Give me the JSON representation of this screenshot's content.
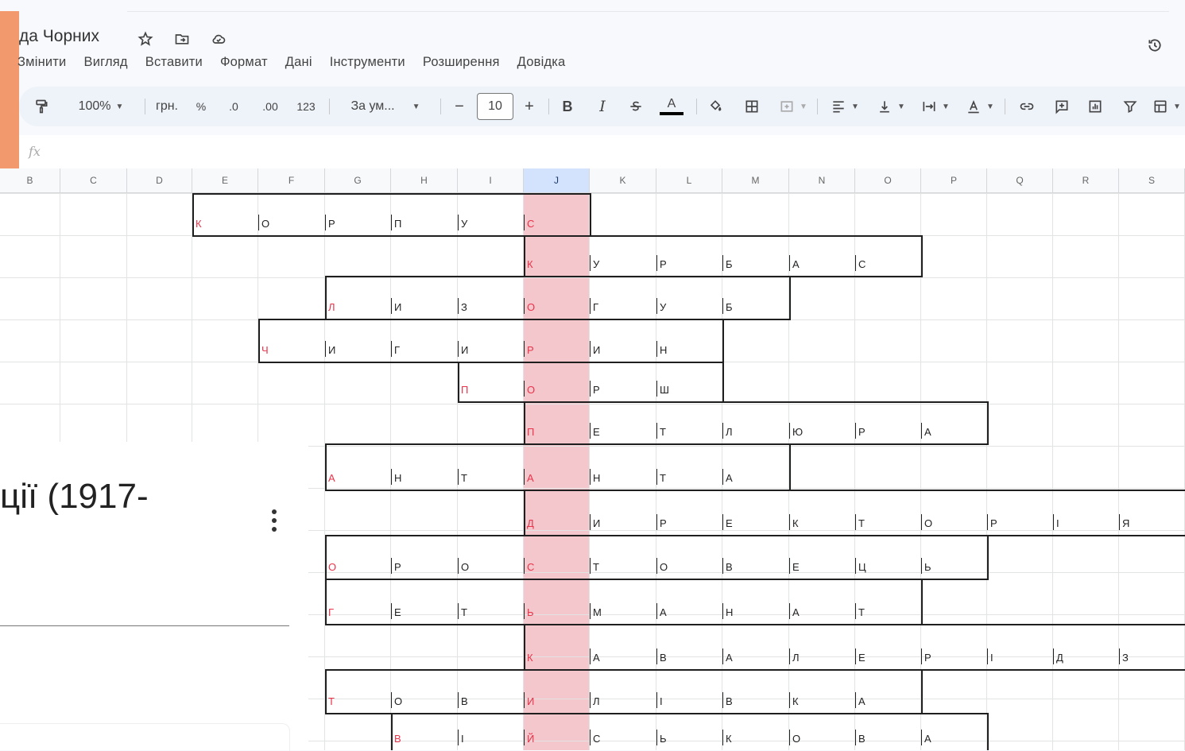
{
  "doc": {
    "title": "да Чорних"
  },
  "menu": [
    "Змінити",
    "Вигляд",
    "Вставити",
    "Формат",
    "Дані",
    "Інструменти",
    "Розширення",
    "Довідка"
  ],
  "toolbar": {
    "zoom": "100%",
    "currency": "грн.",
    "percent": "%",
    "dec_decrease": ".0",
    "dec_increase": ".00",
    "number_format": "123",
    "font": "За ум...",
    "minus": "−",
    "font_size": "10",
    "plus": "+",
    "bold": "B",
    "italic": "I",
    "text_color_glyph": "A"
  },
  "formula_bar": {
    "fx": "fx"
  },
  "columns": [
    "B",
    "C",
    "D",
    "E",
    "F",
    "G",
    "H",
    "I",
    "J",
    "K",
    "L",
    "M",
    "N",
    "O",
    "P",
    "Q",
    "R",
    "S"
  ],
  "selected_column": "J",
  "crossword": {
    "highlight_column": "J",
    "rows": [
      {
        "start": 3,
        "letters": [
          "К",
          "О",
          "Р",
          "П",
          "У",
          "С"
        ]
      },
      {
        "start": 8,
        "letters": [
          "К",
          "У",
          "Р",
          "Б",
          "А",
          "С"
        ]
      },
      {
        "start": 5,
        "letters": [
          "Л",
          "И",
          "З",
          "О",
          "Г",
          "У",
          "Б"
        ]
      },
      {
        "start": 4,
        "letters": [
          "Ч",
          "И",
          "Г",
          "И",
          "Р",
          "И",
          "Н"
        ]
      },
      {
        "start": 7,
        "letters": [
          "П",
          "О",
          "Р",
          "Ш"
        ]
      },
      {
        "start": 8,
        "letters": [
          "П",
          "Е",
          "Т",
          "Л",
          "Ю",
          "Р",
          "А"
        ]
      },
      {
        "start": 5,
        "letters": [
          "А",
          "Н",
          "Т",
          "А",
          "Н",
          "Т",
          "А"
        ]
      },
      {
        "start": 8,
        "letters": [
          "Д",
          "И",
          "Р",
          "Е",
          "К",
          "Т",
          "О",
          "Р",
          "І",
          "Я"
        ]
      },
      {
        "start": 5,
        "letters": [
          "О",
          "Р",
          "О",
          "С",
          "Т",
          "О",
          "В",
          "Е",
          "Ц",
          "Ь"
        ]
      },
      {
        "start": 5,
        "letters": [
          "Г",
          "Е",
          "Т",
          "Ь",
          "М",
          "А",
          "Н",
          "А",
          "Т"
        ]
      },
      {
        "start": 8,
        "letters": [
          "К",
          "А",
          "В",
          "А",
          "Л",
          "Е",
          "Р",
          "І",
          "Д",
          "З"
        ]
      },
      {
        "start": 5,
        "letters": [
          "Т",
          "О",
          "В",
          "И",
          "Л",
          "І",
          "В",
          "К",
          "А"
        ]
      },
      {
        "start": 6,
        "letters": [
          "В",
          "І",
          "Й",
          "С",
          "Ь",
          "К",
          "О",
          "В",
          "А"
        ]
      }
    ]
  },
  "side_card": {
    "title": "ції (1917-"
  }
}
